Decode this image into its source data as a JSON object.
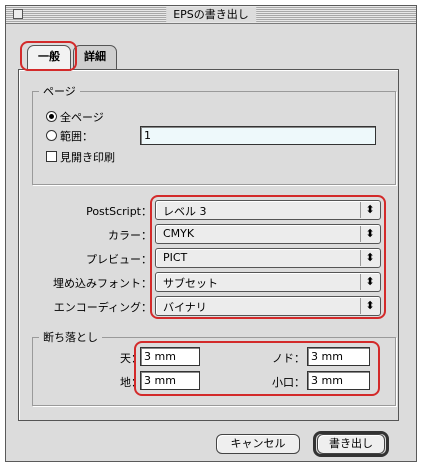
{
  "window": {
    "title": "EPSの書き出し"
  },
  "tabs": [
    {
      "label": "一般",
      "active": true
    },
    {
      "label": "詳細",
      "active": false
    }
  ],
  "pages": {
    "group_label": "ページ",
    "all_label": "全ページ",
    "range_label": "範囲：",
    "range_value": "1",
    "spreads_label": "見開き印刷",
    "selected": "all"
  },
  "format": {
    "postscript_label": "PostScript：",
    "postscript_value": "レベル 3",
    "color_label": "カラー：",
    "color_value": "CMYK",
    "preview_label": "プレビュー：",
    "preview_value": "PICT",
    "embed_fonts_label": "埋め込みフォント：",
    "embed_fonts_value": "サブセット",
    "encoding_label": "エンコーディング：",
    "encoding_value": "バイナリ"
  },
  "bleed": {
    "group_label": "断ち落とし",
    "top_label": "天：",
    "top_value": "3 mm",
    "bottom_label": "地：",
    "bottom_value": "3 mm",
    "gutter_label": "ノド：",
    "gutter_value": "3 mm",
    "fore_edge_label": "小口：",
    "fore_edge_value": "3 mm"
  },
  "buttons": {
    "cancel": "キャンセル",
    "export": "書き出し"
  },
  "colors": {
    "highlight": "#d32a2a",
    "dialog_bg": "#dcdcdc",
    "range_field_bg": "#eef9fb"
  }
}
